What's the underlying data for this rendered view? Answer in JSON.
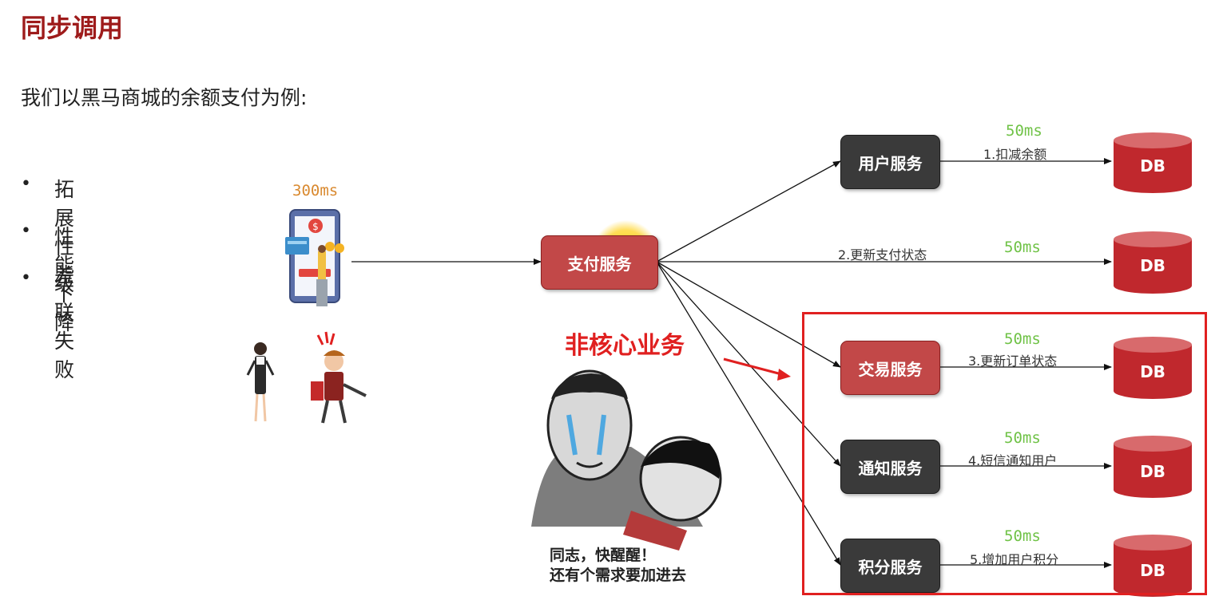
{
  "page": {
    "title": "同步调用",
    "intro": "我们以黑马商城的余额支付为例:",
    "bullets": [
      "拓展性差",
      "性能下降",
      "级联失败"
    ]
  },
  "phone": {
    "latency": "300ms"
  },
  "pay_service": {
    "label": "支付服务"
  },
  "services": [
    {
      "label": "用户服务",
      "style": "dark",
      "edge_label": "1.扣减余额",
      "latency": "50ms",
      "db": "DB"
    },
    {
      "label": "",
      "style": "none",
      "edge_label": "2.更新支付状态",
      "latency": "50ms",
      "db": "DB"
    },
    {
      "label": "交易服务",
      "style": "red",
      "edge_label": "3.更新订单状态",
      "latency": "50ms",
      "db": "DB"
    },
    {
      "label": "通知服务",
      "style": "dark",
      "edge_label": "4.短信通知用户",
      "latency": "50ms",
      "db": "DB"
    },
    {
      "label": "积分服务",
      "style": "dark",
      "edge_label": "5.增加用户积分",
      "latency": "50ms",
      "db": "DB"
    }
  ],
  "non_core_label": "非核心业务",
  "meme": {
    "line1": "同志，快醒醒！",
    "line2": "还有个需求要加进去"
  },
  "colors": {
    "title": "#9e1b1b",
    "latency": "#6fc246",
    "phone_latency": "#d9892f",
    "db": "#c0282d",
    "highlight": "#e02020",
    "service_dark": "#3a3a3a",
    "service_red": "#c24848"
  }
}
